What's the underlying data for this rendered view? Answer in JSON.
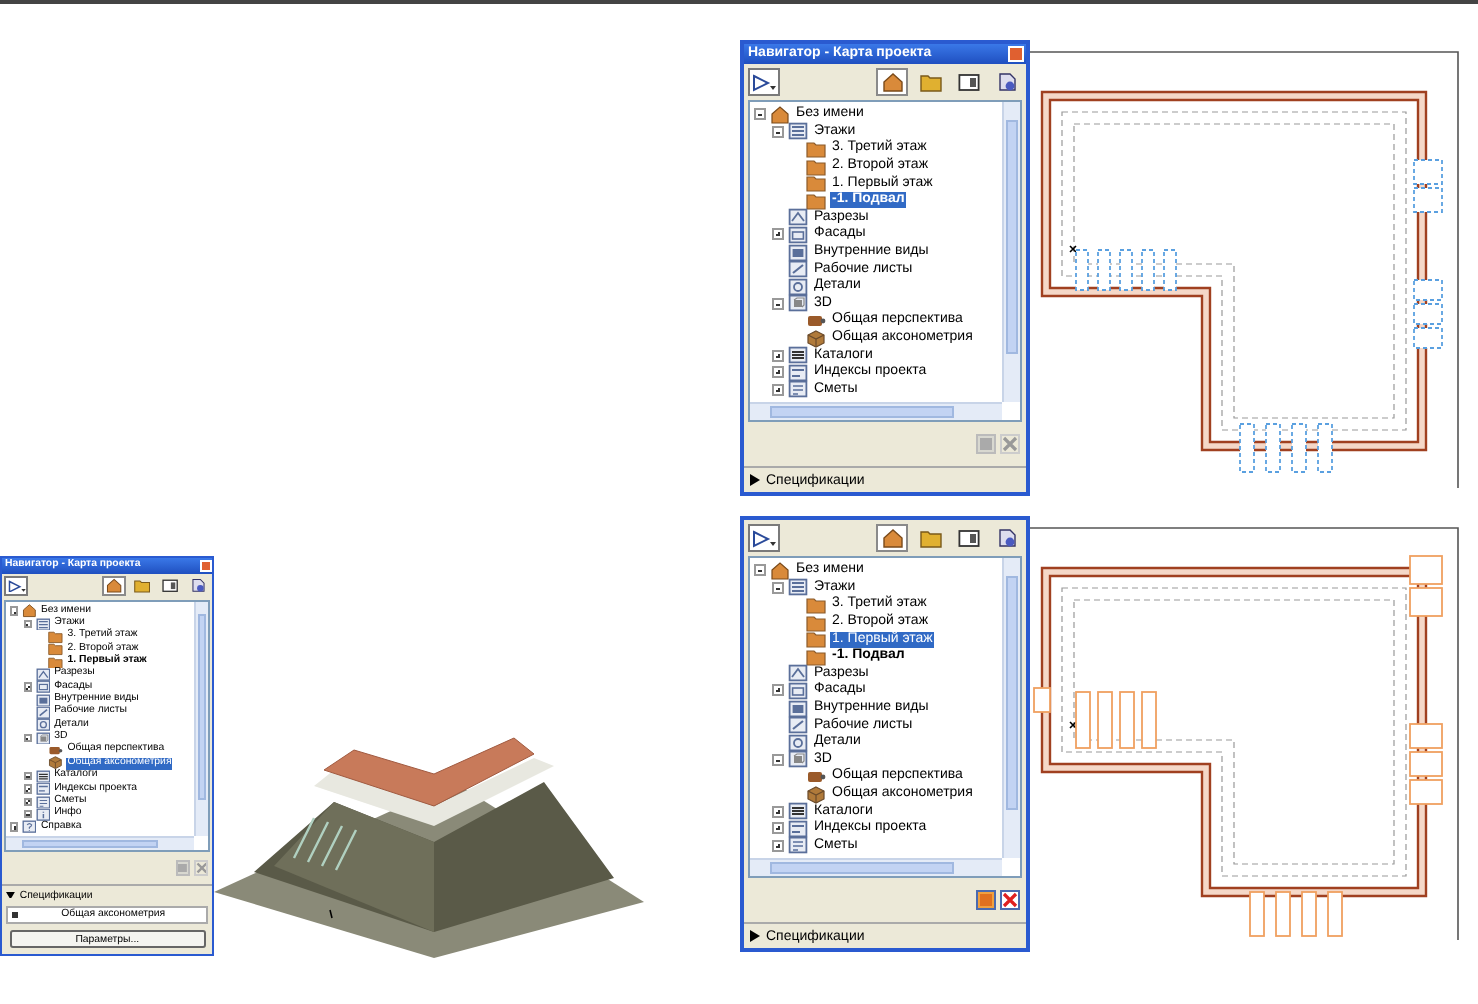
{
  "navigator_top": {
    "title": "Навигатор - Карта проекта",
    "tabs": [
      {
        "kind": "project",
        "selected": true
      },
      {
        "kind": "views",
        "selected": false
      },
      {
        "kind": "layouts",
        "selected": false
      },
      {
        "kind": "publish",
        "selected": false
      }
    ],
    "tree": [
      {
        "label": "Без имени",
        "kind": "project",
        "expanded": true,
        "selected": false,
        "children": [
          {
            "label": "Этажи",
            "kind": "floors",
            "expanded": true,
            "selected": false,
            "children": [
              {
                "label": "3. Третий этаж",
                "kind": "floor",
                "selected": false,
                "current": false
              },
              {
                "label": "2. Второй этаж",
                "kind": "floor",
                "selected": false,
                "current": false
              },
              {
                "label": "1. Первый этаж",
                "kind": "floor",
                "selected": false,
                "current": false
              },
              {
                "label": "-1. Подвал",
                "kind": "floor",
                "selected": true,
                "current": true
              }
            ]
          },
          {
            "label": "Разрезы",
            "kind": "section",
            "selected": false
          },
          {
            "label": "Фасады",
            "kind": "elevation",
            "expanded": false,
            "selected": false
          },
          {
            "label": "Внутренние виды",
            "kind": "interior",
            "selected": false
          },
          {
            "label": "Рабочие листы",
            "kind": "worksheet",
            "selected": false
          },
          {
            "label": "Детали",
            "kind": "detail",
            "selected": false
          },
          {
            "label": "3D",
            "kind": "model",
            "expanded": true,
            "selected": false,
            "children": [
              {
                "label": "Общая перспектива",
                "kind": "perspective",
                "selected": false
              },
              {
                "label": "Общая аксонометрия",
                "kind": "axon",
                "selected": false
              }
            ]
          },
          {
            "label": "Каталоги",
            "kind": "catalog",
            "expanded": false,
            "selected": false
          },
          {
            "label": "Индексы проекта",
            "kind": "index",
            "expanded": false,
            "selected": false
          },
          {
            "label": "Сметы",
            "kind": "list",
            "expanded": false,
            "selected": false
          }
        ]
      }
    ],
    "actions_enabled": false,
    "section": {
      "label": "Спецификации",
      "expanded": false
    }
  },
  "plan_top": {
    "kind": "ghost"
  },
  "navigator_small": {
    "title": "Навигатор - Карта проекта",
    "tabs": [
      {
        "kind": "project",
        "selected": true
      },
      {
        "kind": "views",
        "selected": false
      },
      {
        "kind": "layouts",
        "selected": false
      },
      {
        "kind": "publish",
        "selected": false
      }
    ],
    "tree": [
      {
        "label": "Без имени",
        "kind": "project",
        "expanded": true,
        "selected": false,
        "children": [
          {
            "label": "Этажи",
            "kind": "floors",
            "expanded": true,
            "selected": false,
            "children": [
              {
                "label": "3. Третий этаж",
                "kind": "floor",
                "selected": false,
                "current": false
              },
              {
                "label": "2. Второй этаж",
                "kind": "floor",
                "selected": false,
                "current": false
              },
              {
                "label": "1. Первый этаж",
                "kind": "floor",
                "selected": false,
                "current": true
              }
            ]
          },
          {
            "label": "Разрезы",
            "kind": "section",
            "selected": false
          },
          {
            "label": "Фасады",
            "kind": "elevation",
            "expanded": false,
            "selected": false
          },
          {
            "label": "Внутренние виды",
            "kind": "interior",
            "selected": false
          },
          {
            "label": "Рабочие листы",
            "kind": "worksheet",
            "selected": false
          },
          {
            "label": "Детали",
            "kind": "detail",
            "selected": false
          },
          {
            "label": "3D",
            "kind": "model",
            "expanded": true,
            "selected": false,
            "children": [
              {
                "label": "Общая перспектива",
                "kind": "perspective",
                "selected": false
              },
              {
                "label": "Общая аксонометрия",
                "kind": "axon",
                "selected": true
              }
            ]
          },
          {
            "label": "Каталоги",
            "kind": "catalog",
            "expanded": false,
            "selected": false
          },
          {
            "label": "Индексы проекта",
            "kind": "index",
            "expanded": false,
            "selected": false
          },
          {
            "label": "Сметы",
            "kind": "list",
            "expanded": false,
            "selected": false
          },
          {
            "label": "Инфо",
            "kind": "info",
            "expanded": false,
            "selected": false
          }
        ]
      },
      {
        "label": "Справка",
        "kind": "help",
        "expanded": false,
        "selected": false
      }
    ],
    "actions_enabled": false,
    "section": {
      "label": "Спецификации",
      "expanded": true,
      "value": "Общая аксонометрия",
      "button": "Параметры..."
    }
  },
  "navigator_bottom": {
    "tabs": [
      {
        "kind": "project",
        "selected": true
      },
      {
        "kind": "views",
        "selected": false
      },
      {
        "kind": "layouts",
        "selected": false
      },
      {
        "kind": "publish",
        "selected": false
      }
    ],
    "tree": [
      {
        "label": "Без имени",
        "kind": "project",
        "expanded": true,
        "selected": false,
        "children": [
          {
            "label": "Этажи",
            "kind": "floors",
            "expanded": true,
            "selected": false,
            "children": [
              {
                "label": "3. Третий этаж",
                "kind": "floor",
                "selected": false,
                "current": false
              },
              {
                "label": "2. Второй этаж",
                "kind": "floor",
                "selected": false,
                "current": false
              },
              {
                "label": "1. Первый этаж",
                "kind": "floor",
                "selected": true,
                "current": false
              },
              {
                "label": "-1. Подвал",
                "kind": "floor",
                "selected": false,
                "current": true
              }
            ]
          },
          {
            "label": "Разрезы",
            "kind": "section",
            "selected": false
          },
          {
            "label": "Фасады",
            "kind": "elevation",
            "expanded": false,
            "selected": false
          },
          {
            "label": "Внутренние виды",
            "kind": "interior",
            "selected": false
          },
          {
            "label": "Рабочие листы",
            "kind": "worksheet",
            "selected": false
          },
          {
            "label": "Детали",
            "kind": "detail",
            "selected": false
          },
          {
            "label": "3D",
            "kind": "model",
            "expanded": true,
            "selected": false,
            "children": [
              {
                "label": "Общая перспектива",
                "kind": "perspective",
                "selected": false
              },
              {
                "label": "Общая аксонометрия",
                "kind": "axon",
                "selected": false
              }
            ]
          },
          {
            "label": "Каталоги",
            "kind": "catalog",
            "expanded": false,
            "selected": false
          },
          {
            "label": "Индексы проекта",
            "kind": "index",
            "expanded": false,
            "selected": false
          },
          {
            "label": "Сметы",
            "kind": "list",
            "expanded": false,
            "selected": false
          }
        ]
      }
    ],
    "actions_enabled": true,
    "section": {
      "label": "Спецификации",
      "expanded": false
    }
  },
  "plan_bottom": {
    "kind": "active"
  }
}
